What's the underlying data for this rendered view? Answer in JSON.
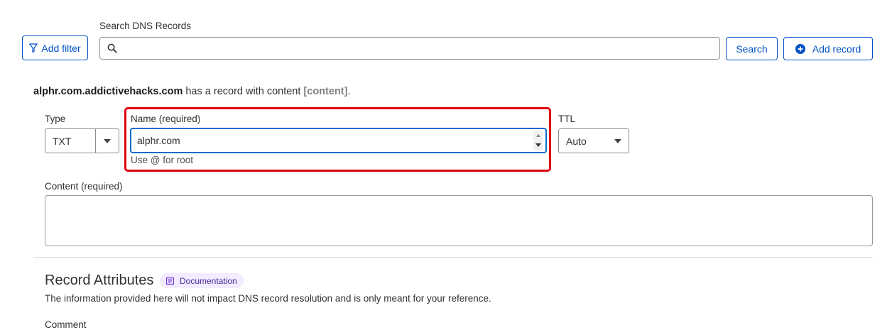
{
  "toolbar": {
    "add_filter_label": "Add filter",
    "search_label": "Search DNS Records",
    "search_value": "",
    "search_button_label": "Search",
    "add_record_label": "Add record"
  },
  "record_notice": {
    "domain": "alphr.com.addictivehacks.com",
    "middle": " has a record with content ",
    "content_token": "[content]",
    "end": "."
  },
  "form": {
    "type_label": "Type",
    "type_value": "TXT",
    "name_label": "Name (required)",
    "name_value": "alphr.com",
    "name_hint": "Use @ for root",
    "ttl_label": "TTL",
    "ttl_value": "Auto",
    "content_label": "Content (required)",
    "content_value": ""
  },
  "attributes": {
    "title": "Record Attributes",
    "doc_badge": "Documentation",
    "description": "The information provided here will not impact DNS record resolution and is only meant for your reference.",
    "comment_label": "Comment"
  },
  "colors": {
    "accent": "#0051c3",
    "highlight": "#e0000f",
    "badge_bg": "#f1ecff",
    "badge_text": "#6c2bd9"
  }
}
